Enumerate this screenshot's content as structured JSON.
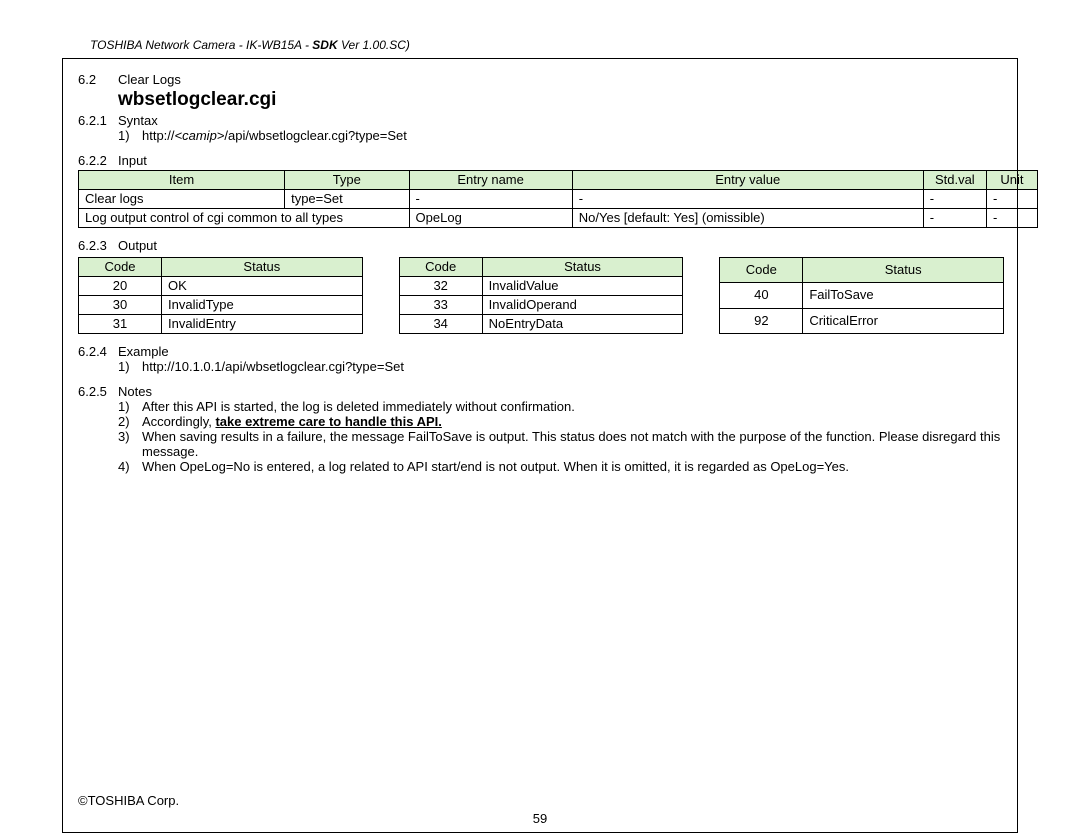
{
  "header": {
    "product_prefix": "TOSHIBA Network Camera - IK-WB15A - ",
    "sdk_label": "SDK",
    "version": " Ver 1.00.SC)"
  },
  "section": {
    "num": "6.2",
    "title": "Clear Logs"
  },
  "cgi_name": "wbsetlogclear.cgi",
  "syntax": {
    "num": "6.2.1",
    "label": "Syntax",
    "items": [
      {
        "n": "1)",
        "prefix": "http://",
        "param": "<camip>",
        "suffix": "/api/wbsetlogclear.cgi?type=Set"
      }
    ]
  },
  "input": {
    "num": "6.2.2",
    "label": "Input",
    "headers": [
      "Item",
      "Type",
      "Entry name",
      "Entry value",
      "Std.val",
      "Unit"
    ],
    "rows": [
      [
        "Clear logs",
        "type=Set",
        "-",
        "-",
        "-",
        "-"
      ],
      [
        "Log output control of cgi common to all types",
        "",
        "OpeLog",
        "No/Yes [default: Yes] (omissible)",
        "-",
        "-"
      ]
    ]
  },
  "output": {
    "num": "6.2.3",
    "label": "Output",
    "code_header": "Code",
    "status_header": "Status",
    "tables": [
      [
        {
          "code": "20",
          "status": "OK"
        },
        {
          "code": "30",
          "status": "InvalidType"
        },
        {
          "code": "31",
          "status": "InvalidEntry"
        }
      ],
      [
        {
          "code": "32",
          "status": "InvalidValue"
        },
        {
          "code": "33",
          "status": "InvalidOperand"
        },
        {
          "code": "34",
          "status": "NoEntryData"
        }
      ],
      [
        {
          "code": "40",
          "status": "FailToSave"
        },
        {
          "code": "92",
          "status": "CriticalError"
        }
      ]
    ]
  },
  "example": {
    "num": "6.2.4",
    "label": "Example",
    "items": [
      {
        "n": "1)",
        "text": "http://10.1.0.1/api/wbsetlogclear.cgi?type=Set"
      }
    ]
  },
  "notes": {
    "num": "6.2.5",
    "label": "Notes",
    "items": [
      {
        "n": "1)",
        "plain": "After this API is started, the log is deleted immediately without confirmation."
      },
      {
        "n": "2)",
        "prefix": "Accordingly, ",
        "bold": "take extreme care to handle this API."
      },
      {
        "n": "3)",
        "plain": "When saving results in a failure, the message FailToSave is output. This status does not match with the purpose of the function. Please disregard this message."
      },
      {
        "n": "4)",
        "plain": "When OpeLog=No is entered, a log related to API start/end is not output. When it is omitted, it is regarded as OpeLog=Yes."
      }
    ]
  },
  "footer": {
    "copyright": "©TOSHIBA Corp.",
    "page": "59"
  }
}
